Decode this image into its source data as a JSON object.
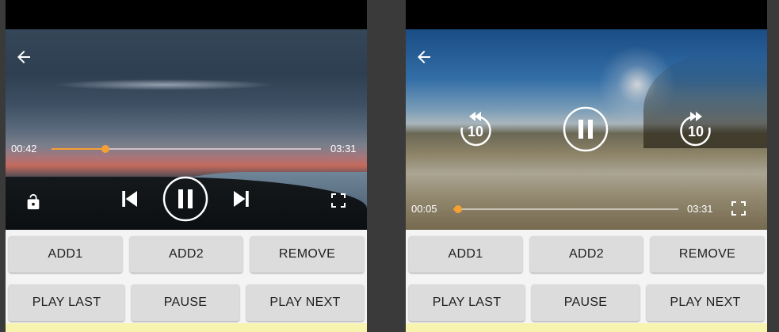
{
  "left_player": {
    "elapsed": "00:42",
    "duration": "03:31",
    "progress": 0.2,
    "icons": [
      "back-arrow-icon",
      "lock-icon",
      "skip-previous-icon",
      "pause-icon",
      "skip-next-icon",
      "fullscreen-icon"
    ]
  },
  "right_player": {
    "elapsed": "00:05",
    "duration": "03:31",
    "progress": 0.02,
    "rewind_seconds": "10",
    "forward_seconds": "10",
    "icons": [
      "back-arrow-icon",
      "rewind-10-icon",
      "pause-icon",
      "forward-10-icon",
      "fullscreen-icon"
    ]
  },
  "buttons": {
    "add1": "ADD1",
    "add2": "ADD2",
    "remove": "REMOVE",
    "play_last": "PLAY LAST",
    "pause": "PAUSE",
    "play_next": "PLAY NEXT"
  },
  "colors": {
    "accent": "#f5a033",
    "button_bg": "#dcdcdc",
    "panel_bg": "#f4f4f4",
    "footer": "#f8f4b0"
  }
}
